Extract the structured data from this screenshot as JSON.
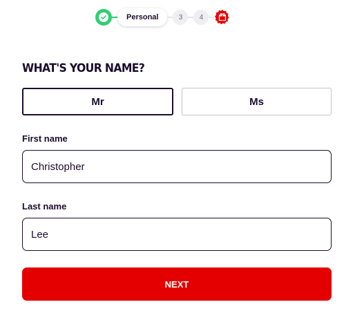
{
  "stepper": {
    "current_label": "Personal",
    "step3": "3",
    "step4": "4",
    "done_icon": "check-circle-icon",
    "final_icon": "gift-icon",
    "colors": {
      "done": "#2ecf73",
      "final": "#e50000"
    }
  },
  "heading": "WHAT'S YOUR NAME?",
  "title_options": {
    "mr": "Mr",
    "ms": "Ms",
    "selected": "Mr"
  },
  "first_name": {
    "label": "First name",
    "value": "Christopher"
  },
  "last_name": {
    "label": "Last name",
    "value": "Lee"
  },
  "next_label": "NEXT",
  "colors": {
    "text": "#1c0d2e",
    "primary": "#e50000",
    "success": "#2ecf73"
  }
}
